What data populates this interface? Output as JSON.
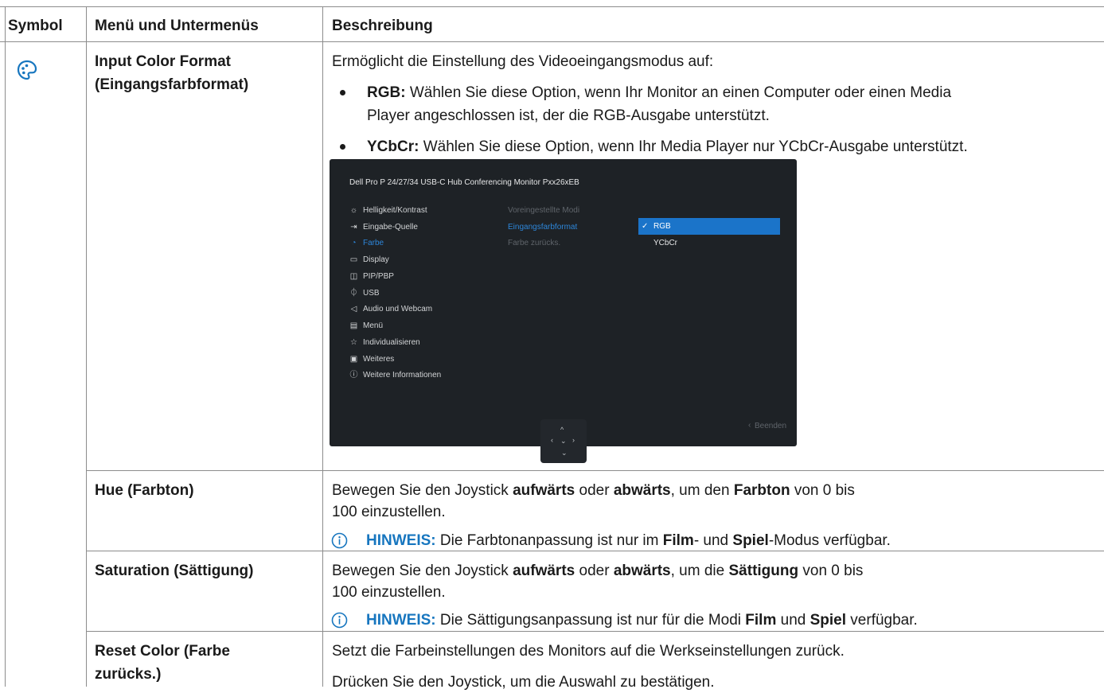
{
  "headers": {
    "symbol": "Symbol",
    "menu": "Menü und Untermenüs",
    "desc": "Beschreibung"
  },
  "icon": "color-palette-icon",
  "colors": {
    "accent": "#1776bf",
    "osd_bg": "#1e2226",
    "osd_select": "#1b74c9"
  },
  "rows": {
    "input": {
      "name1": "Input Color Format",
      "name2": "(Eingangsfarbformat)",
      "intro": "Ermöglicht die Einstellung des Videoeingangsmodus auf:",
      "rgb_label": "RGB:",
      "rgb_text1": " Wählen Sie diese Option, wenn Ihr Monitor an einen Computer oder einen Media",
      "rgb_text2": "Player angeschlossen ist, der die RGB-Ausgabe unterstützt.",
      "ycbcr_label": "YCbCr:",
      "ycbcr_text": " Wählen Sie diese Option, wenn Ihr Media Player nur YCbCr-Ausgabe unterstützt."
    },
    "hue": {
      "name": "Hue (Farbton)",
      "t1": "Bewegen Sie den Joystick ",
      "t2": "aufwärts",
      "t3": " oder ",
      "t4": "abwärts",
      "t5": ", um den ",
      "t6": "Farbton",
      "t7": " von 0 bis",
      "line2": "100 einzustellen.",
      "note_label": "HINWEIS:",
      "n1": " Die Farbtonanpassung ist nur im ",
      "n2": "Film",
      "n3": "- und ",
      "n4": "Spiel",
      "n5": "-Modus verfügbar."
    },
    "sat": {
      "name": "Saturation (Sättigung)",
      "t1": "Bewegen Sie den Joystick ",
      "t2": "aufwärts",
      "t3": " oder ",
      "t4": "abwärts",
      "t5": ", um die ",
      "t6": "Sättigung",
      "t7": " von 0 bis",
      "line2": "100 einzustellen.",
      "note_label": "HINWEIS:",
      "n1": " Die Sättigungsanpassung ist nur für die Modi ",
      "n2": "Film",
      "n3": " und ",
      "n4": "Spiel",
      "n5": " verfügbar."
    },
    "reset": {
      "name1": "Reset Color (Farbe",
      "name2": "zurücks.)",
      "line1": "Setzt die Farbeinstellungen des Monitors auf die Werkseinstellungen zurück.",
      "line2": "Drücken Sie den Joystick, um die Auswahl zu bestätigen."
    }
  },
  "osd": {
    "title": "Dell Pro P 24/27/34 USB-C Hub Conferencing Monitor  Pxx26xEB",
    "menu": [
      {
        "icon": "brightness-icon",
        "label": "Helligkeit/Kontrast"
      },
      {
        "icon": "input-source-icon",
        "label": "Eingabe-Quelle"
      },
      {
        "icon": "color-icon",
        "label": "Farbe"
      },
      {
        "icon": "display-icon",
        "label": "Display"
      },
      {
        "icon": "pip-pbp-icon",
        "label": "PIP/PBP"
      },
      {
        "icon": "usb-icon",
        "label": "USB"
      },
      {
        "icon": "audio-icon",
        "label": "Audio und Webcam"
      },
      {
        "icon": "menu-icon",
        "label": "Menü"
      },
      {
        "icon": "star-icon",
        "label": "Individualisieren"
      },
      {
        "icon": "others-icon",
        "label": "Weiteres"
      },
      {
        "icon": "info-icon",
        "label": "Weitere Informationen"
      }
    ],
    "submenu": [
      "Voreingestellte Modi",
      "Eingangsfarbformat",
      "Farbe zurücks."
    ],
    "options": [
      "RGB",
      "YCbCr"
    ],
    "exit": "Beenden"
  }
}
